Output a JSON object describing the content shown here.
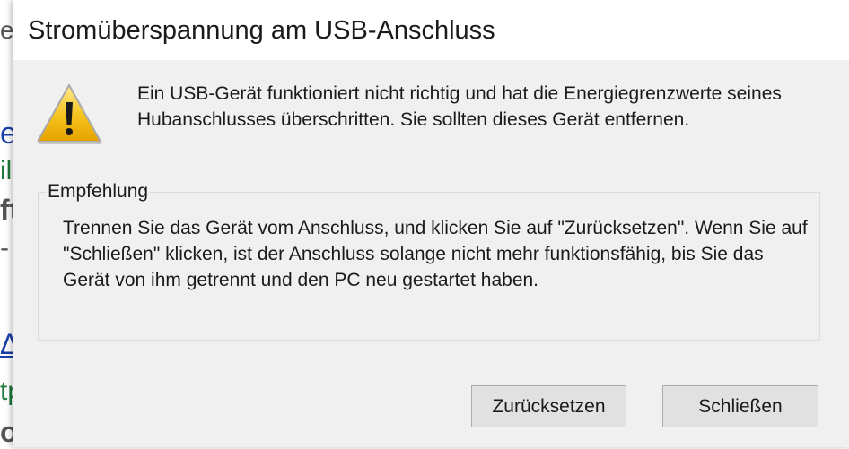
{
  "background": {
    "fragments": [
      {
        "text": "eu",
        "color": "#555555"
      },
      {
        "text": "er",
        "color": "#1a3fa8"
      },
      {
        "text": "il",
        "color": "#1f7a3a"
      },
      {
        "text": "ft",
        "color": "#555555"
      },
      {
        "text": "-",
        "color": "#555555"
      },
      {
        "text": "Δ",
        "color": "#1a3fa8"
      },
      {
        "text": "tp",
        "color": "#1f7a3a"
      },
      {
        "text": "o",
        "color": "#555555"
      }
    ]
  },
  "dialog": {
    "title": "Stromüberspannung am USB-Anschluss",
    "icon": "warning-triangle-icon",
    "message": "Ein USB-Gerät funktioniert nicht richtig und hat die Energiegrenzwerte seines Hubanschlusses überschritten. Sie sollten dieses Gerät entfernen.",
    "group_label": "Empfehlung",
    "recommendation": "Trennen Sie das Gerät vom Anschluss, und klicken Sie auf \"Zurücksetzen\". Wenn Sie auf \"Schließen\" klicken, ist der Anschluss solange nicht mehr funktionsfähig, bis Sie das Gerät von ihm getrennt und den PC neu gestartet haben.",
    "buttons": {
      "reset_label": "Zurücksetzen",
      "close_label": "Schließen"
    }
  }
}
